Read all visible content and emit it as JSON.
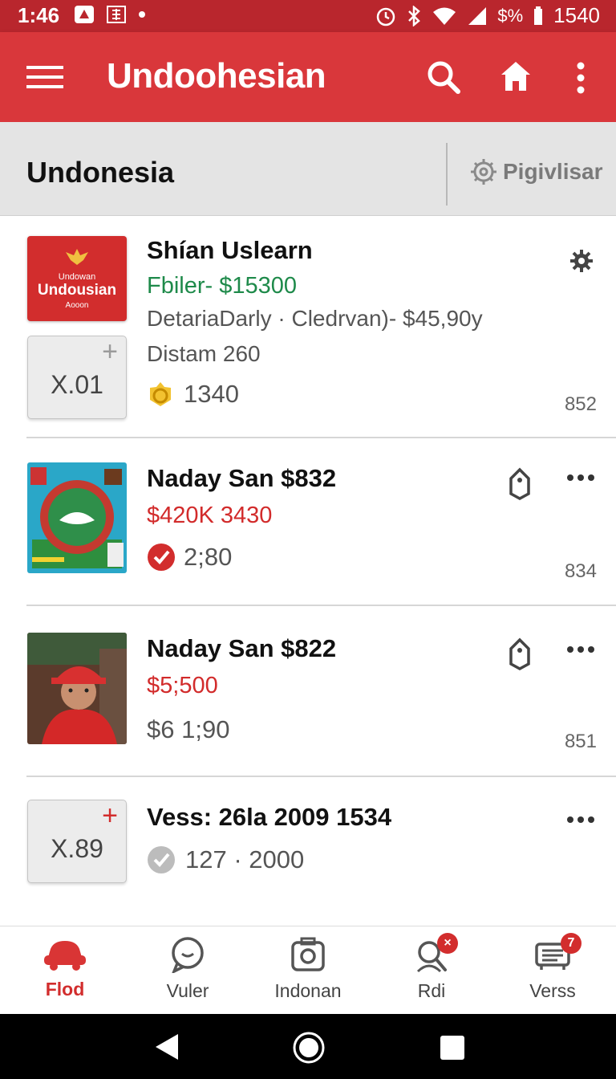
{
  "status_bar": {
    "time": "1:46",
    "battery_text": "1540",
    "percent_text": "$%"
  },
  "app_bar": {
    "title": "Undoohesian",
    "icons": [
      "menu-icon",
      "search-icon",
      "home-icon",
      "more-vert-icon"
    ]
  },
  "sub_header": {
    "title": "Undonesia",
    "filter_label": "Pigivlisar"
  },
  "listings": [
    {
      "thumb_line1": "Undowan",
      "thumb_line2": "Undousian",
      "thumb_line3": "Aooon",
      "quantity": "X.01",
      "name": "Shían Uslearn",
      "price": "Fbiler- $15300",
      "details": "DetariaDarly · Cledrvan)- $45,90y",
      "distance": "Distam 260",
      "rating_value": "1340",
      "count": "852"
    },
    {
      "name": "Naday San $832",
      "price": "$420K 3430",
      "rating_value": "2;80",
      "count": "834"
    },
    {
      "name": "Naday San $822",
      "price": "$5;500",
      "secondary": "$6 1;90",
      "count": "851"
    },
    {
      "quantity": "X.89",
      "name": "Vess: 26la 2009 1534",
      "rating_value": "127 · 2000"
    }
  ],
  "bottom_nav": [
    {
      "label": "Flod",
      "icon": "car-icon",
      "active": true
    },
    {
      "label": "Vuler",
      "icon": "chat-icon"
    },
    {
      "label": "Indonan",
      "icon": "camera-icon"
    },
    {
      "label": "Rdi",
      "icon": "search-user-icon",
      "badge": "×"
    },
    {
      "label": "Verss",
      "icon": "list-icon",
      "badge": "7"
    }
  ],
  "colors": {
    "primary": "#d9373b",
    "status_bar": "#b9262d",
    "price_green": "#1e8a4a",
    "price_red": "#d22b2b"
  }
}
